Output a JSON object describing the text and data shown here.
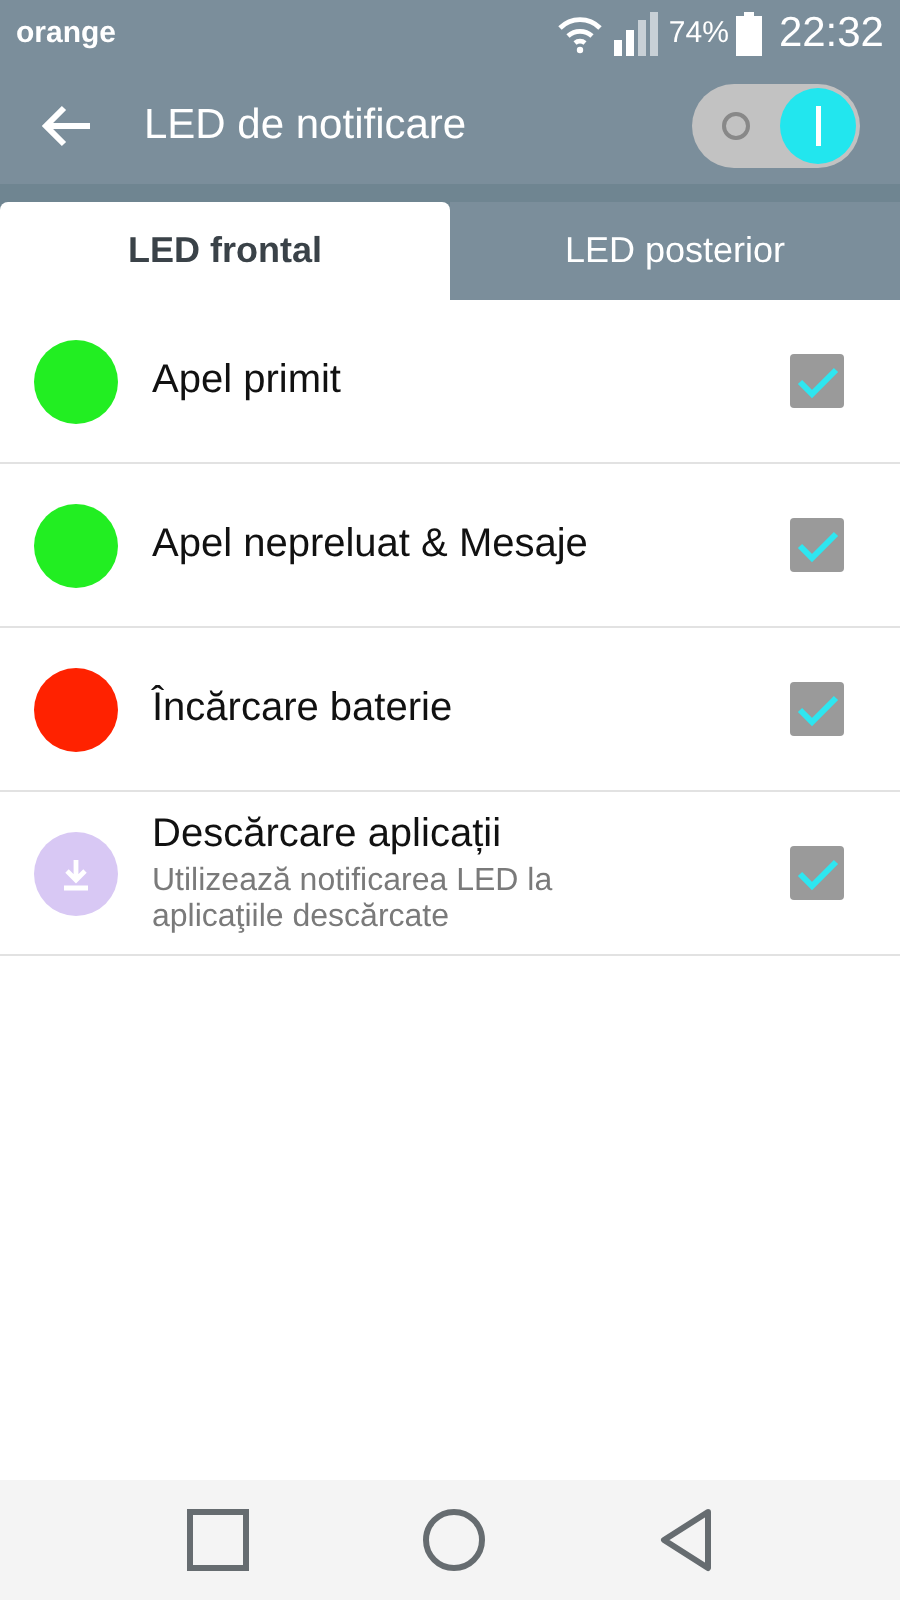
{
  "status_bar": {
    "carrier": "orange",
    "battery": "74%",
    "time": "22:32"
  },
  "action_bar": {
    "title": "LED de notificare",
    "switch": {
      "on": true
    }
  },
  "tabs": [
    {
      "label": "LED frontal",
      "selected": true
    },
    {
      "label": "LED posterior",
      "selected": false
    }
  ],
  "items": [
    {
      "kind": "color",
      "color": "#22ee22",
      "title": "Apel primit",
      "checked": true
    },
    {
      "kind": "color",
      "color": "#22ee22",
      "title": "Apel nepreluat & Mesaje",
      "checked": true
    },
    {
      "kind": "color",
      "color": "#ff2200",
      "title": "Încărcare baterie",
      "checked": true
    },
    {
      "kind": "icon",
      "title": "Descărcare aplicații",
      "subtitle": "Utilizează notificarea LED la aplicaţiile descărcate",
      "checked": true
    }
  ]
}
